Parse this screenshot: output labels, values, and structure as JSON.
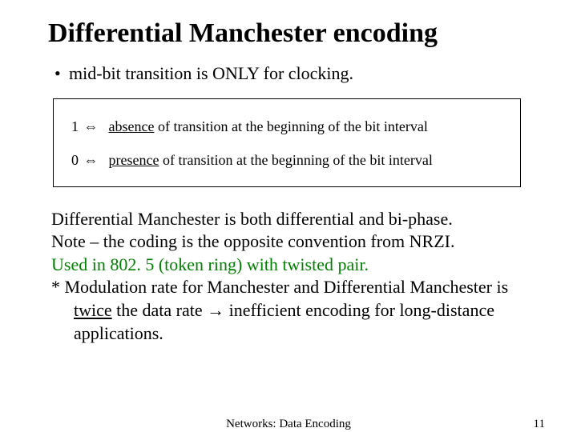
{
  "title": "Differential Manchester encoding",
  "bullet1": "mid-bit transition is ONLY for clocking.",
  "rule1_bit": "1",
  "rule1_arrow": "⇔",
  "rule1_uword": "absence",
  "rule1_rest": " of transition at the beginning of the bit interval",
  "rule0_bit": "0",
  "rule0_arrow": "⇔",
  "rule0_uword": "presence",
  "rule0_rest": " of transition at the beginning of the bit interval",
  "body_line1": "Differential Manchester is both differential and bi-phase.",
  "body_line2": "Note – the coding is the opposite convention from NRZI.",
  "body_line3": "Used in 802. 5 (token ring) with twisted pair.",
  "body_line4_a": "* Modulation rate for Manchester and Differential Manchester is",
  "body_line4_b_u": "twice",
  "body_line4_b_rest": " the data rate ",
  "body_line4_b_arrow": "→",
  "body_line4_b_tail": " inefficient encoding for long-distance",
  "body_line4_c": "applications.",
  "footer_center": "Networks: Data Encoding",
  "footer_page": "11"
}
